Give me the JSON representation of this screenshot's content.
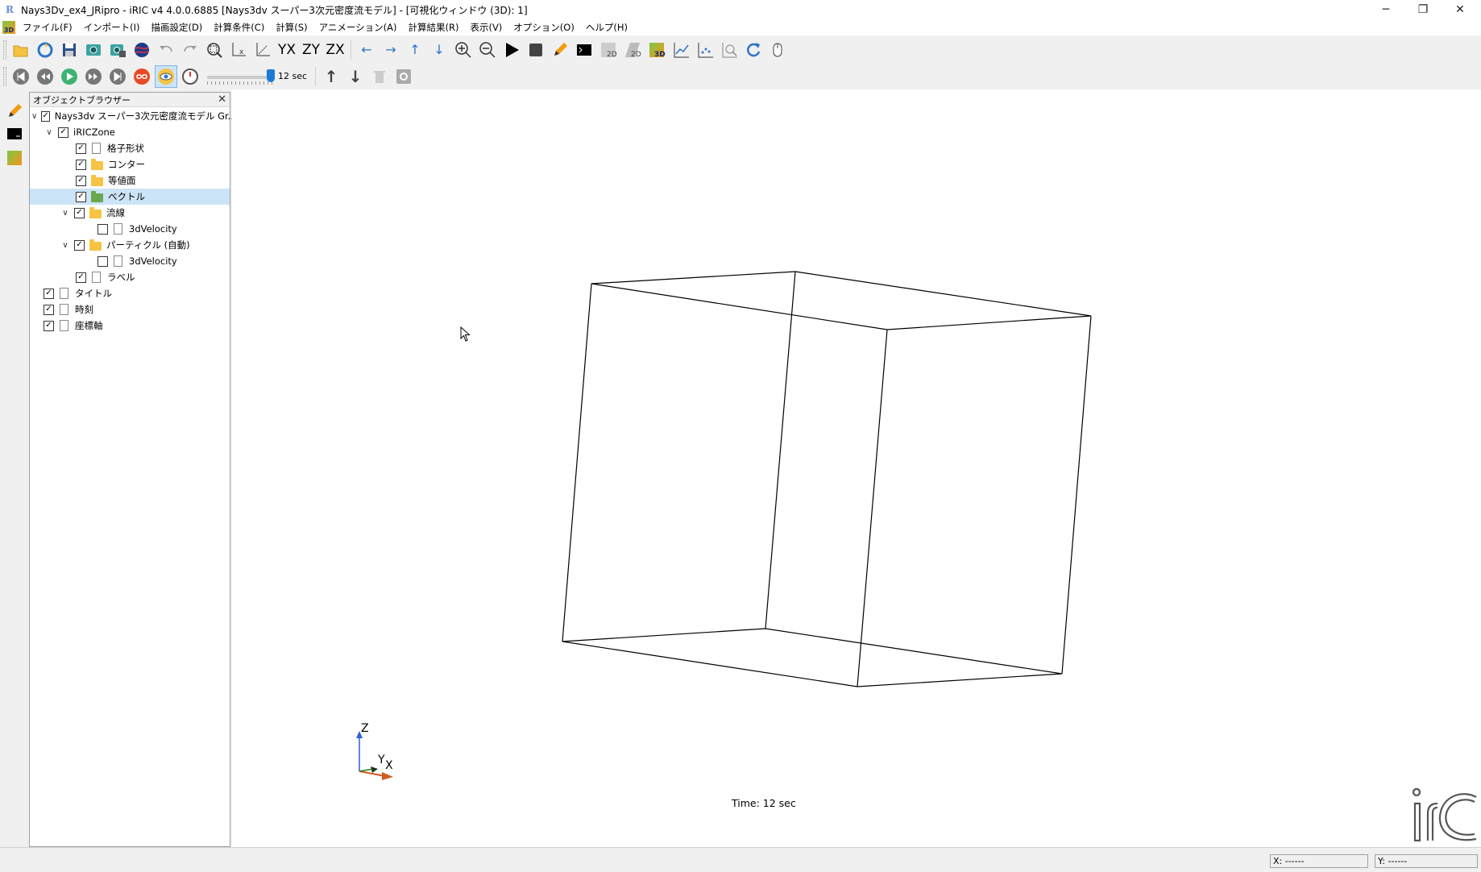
{
  "window": {
    "title": "Nays3Dv_ex4_JRipro - iRIC v4 4.0.0.6885 [Nays3dv スーパー3次元密度流モデル] - [可視化ウィンドウ (3D): 1]",
    "app_icon_glyph": "R",
    "minimize": "─",
    "restore": "❐",
    "close": "✕",
    "mdi_glyph": "3D"
  },
  "menu": [
    "ファイル(F)",
    "インポート(I)",
    "描画設定(D)",
    "計算条件(C)",
    "計算(S)",
    "アニメーション(A)",
    "計算結果(R)",
    "表示(V)",
    "オプション(O)",
    "ヘルプ(H)"
  ],
  "mdi_controls": {
    "minimize": "–",
    "restore": "⧉",
    "close": "✕"
  },
  "toolbar": {
    "axis_yx": "YX",
    "axis_zy": "ZY",
    "axis_zx": "ZX",
    "badge_2d": "2D",
    "badge_2d_b": "2D",
    "badge_3d": "3D"
  },
  "animation": {
    "time_label": "12 sec",
    "slider_value": 1.0
  },
  "object_browser": {
    "title": "オブジェクトブラウザー",
    "close": "✕",
    "items": [
      {
        "label": "Nays3dv スーパー3次元密度流モデル Gr...",
        "checked": true
      },
      {
        "label": "iRICZone",
        "checked": true
      },
      {
        "label": "格子形状",
        "checked": true
      },
      {
        "label": "コンター",
        "checked": true
      },
      {
        "label": "等値面",
        "checked": true
      },
      {
        "label": "ベクトル",
        "checked": true
      },
      {
        "label": "流線",
        "checked": true
      },
      {
        "label": "3dVelocity",
        "checked": false
      },
      {
        "label": "パーティクル (自動)",
        "checked": true
      },
      {
        "label": "3dVelocity",
        "checked": false
      },
      {
        "label": "ラベル",
        "checked": true
      },
      {
        "label": "タイトル",
        "checked": true
      },
      {
        "label": "時刻",
        "checked": true
      },
      {
        "label": "座標軸",
        "checked": true
      }
    ],
    "expand_glyph": "∨",
    "check_glyph": "✓"
  },
  "viewport": {
    "time_text": "Time:  12 sec",
    "axes": {
      "z": "Z",
      "y": "Y",
      "x": "X"
    },
    "logo_text": "iR"
  },
  "status": {
    "x": "X: ------",
    "y": "Y: ------"
  },
  "colors": {
    "selection": "#cce4f7",
    "accent": "#1f7ad6"
  }
}
